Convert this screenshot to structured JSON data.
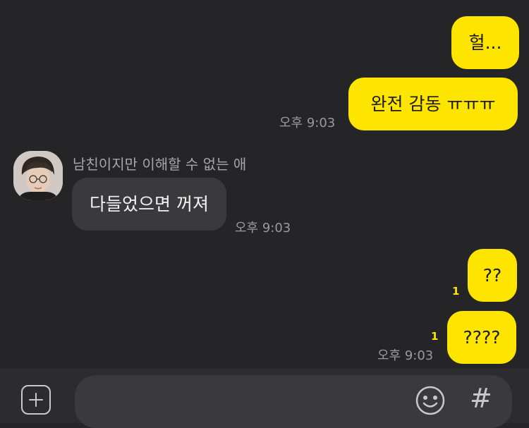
{
  "messages": {
    "m1": {
      "text": "헐..."
    },
    "m2": {
      "text": "완전 감동 ㅠㅠㅠ"
    },
    "m2_time": "오후 9:03",
    "sender_name": "남친이지만 이해할 수 없는 애",
    "m3": {
      "text": "다들었으면 꺼져"
    },
    "m3_time": "오후 9:03",
    "m4": {
      "text": "??",
      "unread": "1"
    },
    "m5": {
      "text": "????",
      "unread": "1"
    },
    "m5_time": "오후 9:03"
  },
  "input": {
    "placeholder": ""
  },
  "icons": {
    "attach": "plus-square-icon",
    "emoji": "smiley-icon",
    "hashtag": "hashtag-icon"
  },
  "colors": {
    "my_bubble": "#fee500",
    "their_bubble": "#3a3a3d",
    "background": "#252528"
  }
}
